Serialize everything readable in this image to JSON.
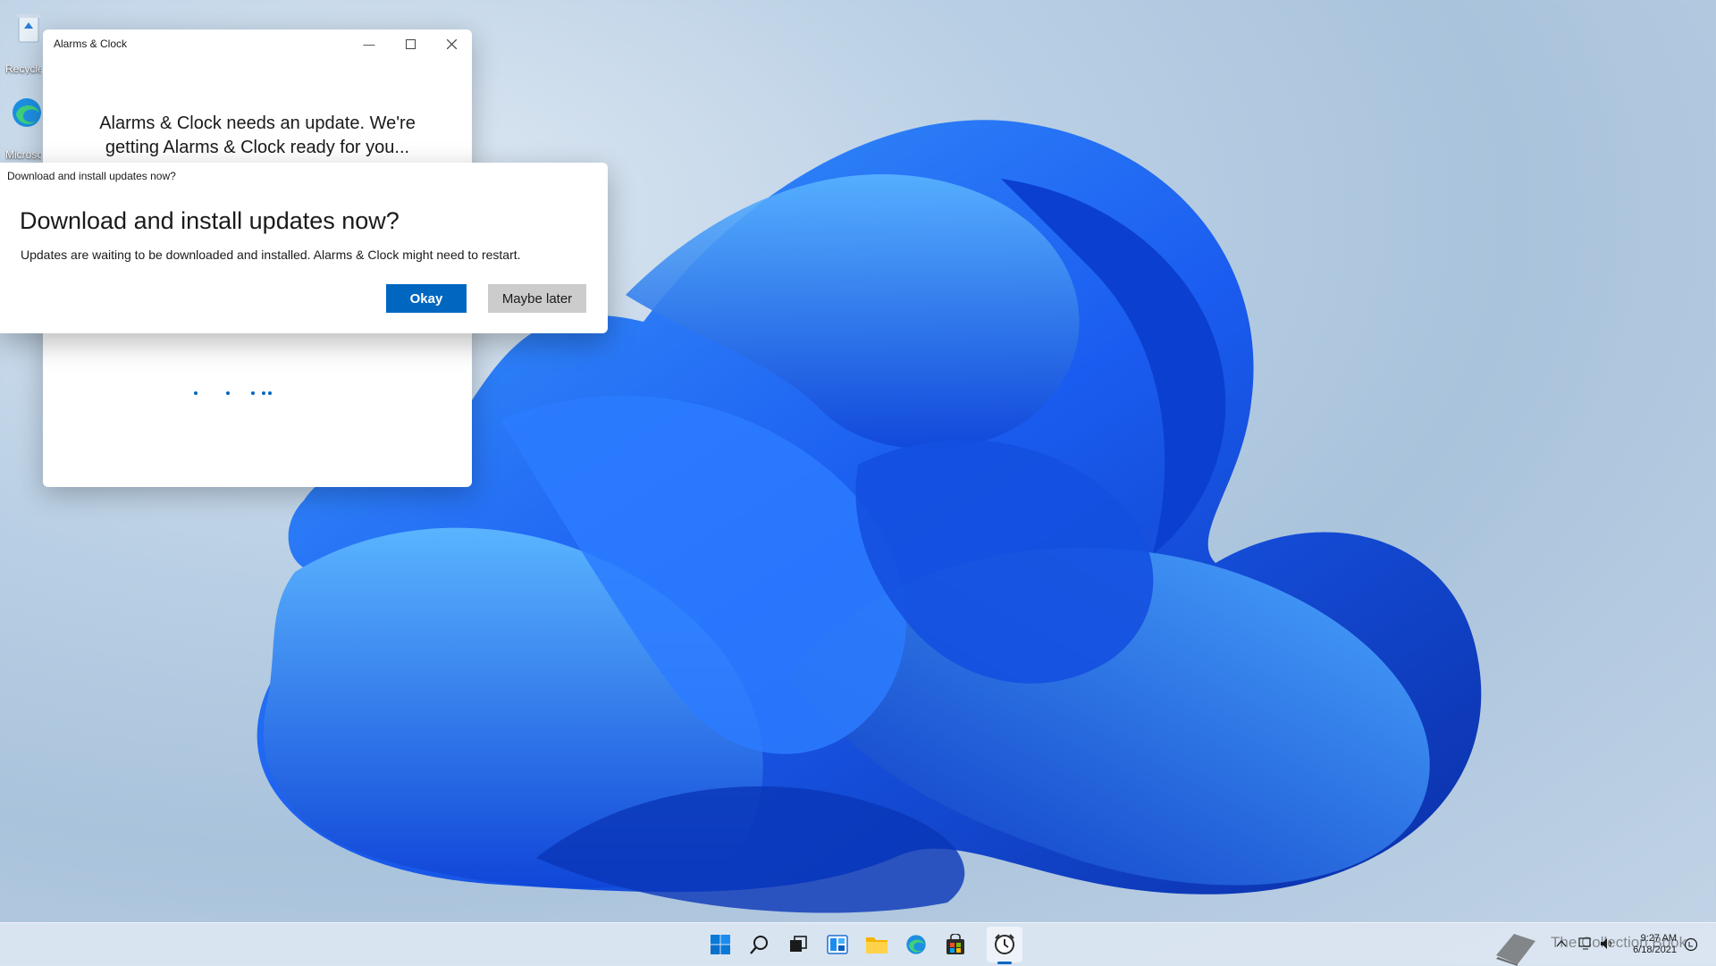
{
  "desktop": {
    "icons": [
      {
        "label": "Recycle Bin",
        "icon": "recycle-bin-icon"
      },
      {
        "label": "Microsoft Edge",
        "icon": "edge-icon"
      }
    ]
  },
  "app_window": {
    "title": "Alarms & Clock",
    "message_line1": "Alarms & Clock needs an update. We're",
    "message_line2": "getting Alarms & Clock ready for you..."
  },
  "dialog": {
    "caption": "Download and install updates now?",
    "heading": "Download and install updates now?",
    "body": "Updates are waiting to be downloaded and installed. Alarms & Clock might need to restart.",
    "primary_label": "Okay",
    "secondary_label": "Maybe later"
  },
  "taskbar": {
    "icons": [
      "start-icon",
      "search-icon",
      "task-view-icon",
      "widgets-icon",
      "file-explorer-icon",
      "edge-icon",
      "store-icon",
      "alarms-clock-icon"
    ],
    "time": "9:27 AM",
    "date": "6/18/2021"
  },
  "watermark": "The Collection Book",
  "colors": {
    "accent": "#0067c0",
    "wallpaper_blue": "#1a5cf0"
  }
}
